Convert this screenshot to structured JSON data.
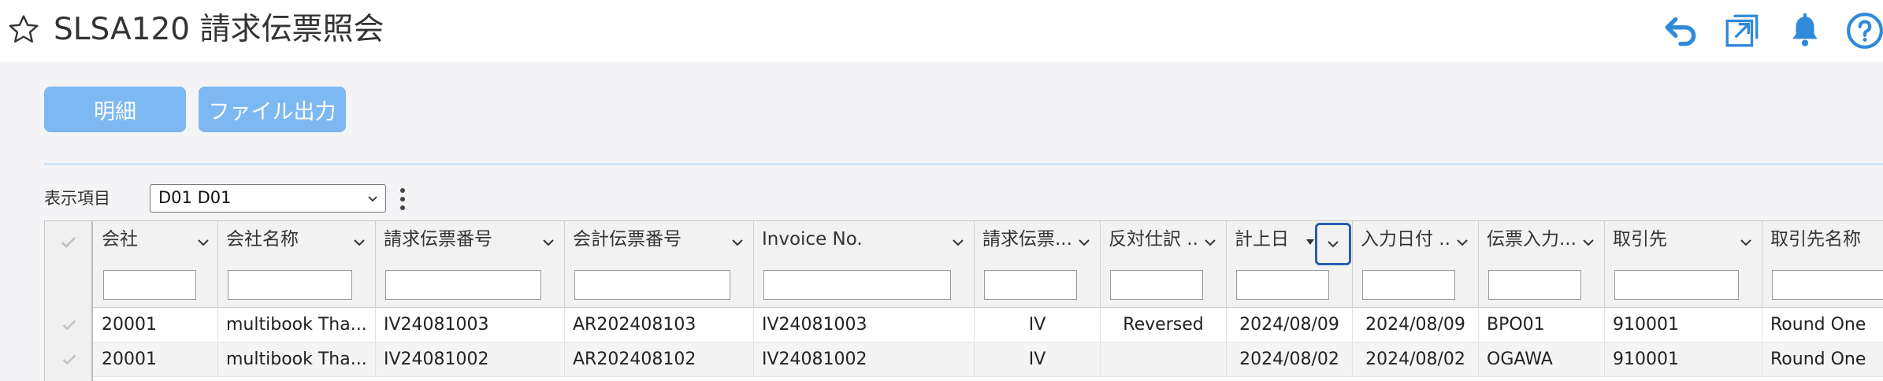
{
  "header": {
    "title": "SLSA120 請求伝票照会",
    "icons": [
      "star-icon",
      "back-icon",
      "external-window-icon",
      "bell-icon",
      "help-icon"
    ],
    "accent": "#2f8ad9"
  },
  "toolbar": {
    "detail_label": "明細",
    "file_output_label": "ファイル出力"
  },
  "display": {
    "label": "表示項目",
    "selected": "D01 D01"
  },
  "table": {
    "columns": [
      "会社",
      "会社名称",
      "請求伝票番号",
      "会計伝票番号",
      "Invoice No.",
      "請求伝票...",
      "反対仕訳 ...",
      "計上日",
      "入力日付 ...",
      "伝票入力...",
      "取引先",
      "取引先名称"
    ],
    "rows": [
      [
        "20001",
        "multibook Tha...",
        "IV24081003",
        "AR202408103",
        "IV24081003",
        "IV",
        "Reversed",
        "2024/08/09",
        "2024/08/09",
        "BPO01",
        "910001",
        "Round One"
      ],
      [
        "20001",
        "multibook Tha...",
        "IV24081002",
        "AR202408102",
        "IV24081002",
        "IV",
        "",
        "2024/08/02",
        "2024/08/02",
        "OGAWA",
        "910001",
        "Round One"
      ]
    ]
  }
}
